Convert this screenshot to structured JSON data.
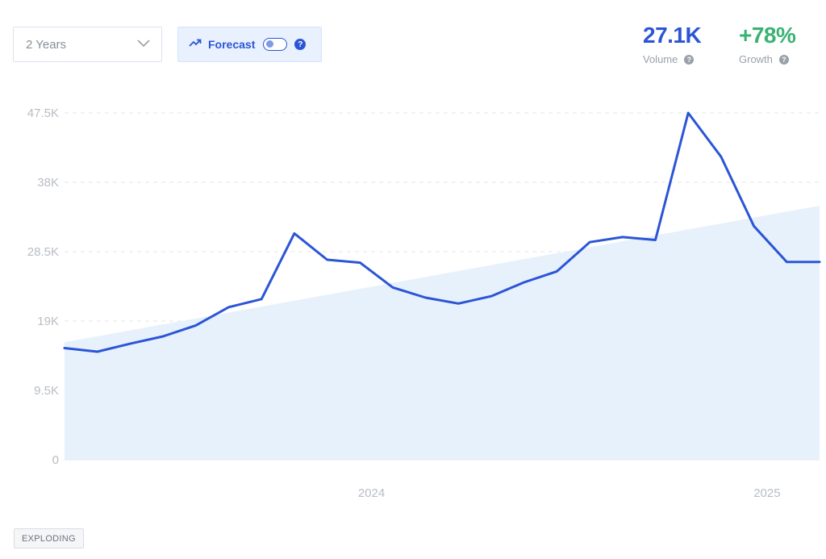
{
  "controls": {
    "period_label": "2 Years",
    "forecast_label": "Forecast",
    "forecast_enabled": false,
    "help_symbol": "?"
  },
  "stats": {
    "volume_value": "27.1K",
    "volume_label": "Volume",
    "growth_value": "+78%",
    "growth_label": "Growth",
    "help_symbol": "?"
  },
  "badge": "EXPLODING",
  "colors": {
    "line": "#2c55d6",
    "growth": "#3bb273",
    "trend_fill": "#e3effc",
    "grid": "#e3e6ea"
  },
  "icons": {
    "period_select": "chevron-down-icon",
    "forecast": "trending-up-icon"
  },
  "chart_data": {
    "type": "line",
    "series": [
      {
        "values": [
          15300,
          14800,
          15900,
          16900,
          18400,
          20900,
          22000,
          31000,
          27400,
          27000,
          23600,
          22200,
          21400,
          22400,
          24300,
          25800,
          29800,
          30500,
          30100,
          47500,
          41500,
          32000,
          27100,
          27100
        ]
      }
    ],
    "trend": {
      "start": 16100,
      "end": 34800
    },
    "x_tick_labels": [
      {
        "label": "2024",
        "index": 9.35
      },
      {
        "label": "2025",
        "index": 21.4
      }
    ],
    "y_ticks": [
      0,
      9500,
      19000,
      28500,
      38000,
      47500
    ],
    "y_tick_labels": [
      "0",
      "9.5K",
      "19K",
      "28.5K",
      "38K",
      "47.5K"
    ],
    "ylim": [
      0,
      47500
    ],
    "grid": true,
    "legend": "none"
  }
}
